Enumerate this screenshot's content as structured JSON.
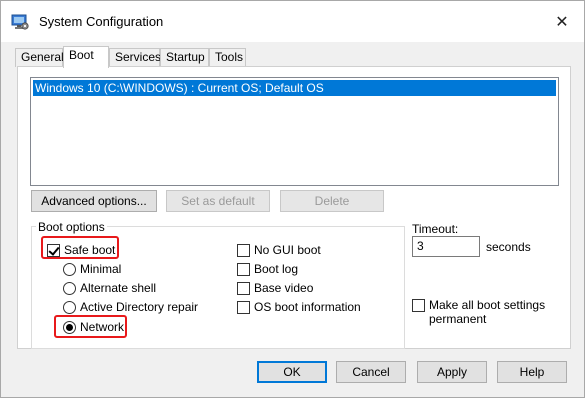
{
  "window": {
    "title": "System Configuration",
    "close_glyph": "✕",
    "app_icon": "monitor-gear-icon"
  },
  "tabs": [
    "General",
    "Boot",
    "Services",
    "Startup",
    "Tools"
  ],
  "active_tab": "Boot",
  "os_list": [
    "Windows 10 (C:\\WINDOWS) : Current OS; Default OS"
  ],
  "buttons": {
    "advanced": "Advanced options...",
    "set_default": "Set as default",
    "delete": "Delete"
  },
  "boot_options": {
    "label": "Boot options",
    "safe_boot": {
      "label": "Safe boot",
      "checked": true
    },
    "minimal": "Minimal",
    "alternate_shell": "Alternate shell",
    "ad_repair": "Active Directory repair",
    "network": {
      "label": "Network",
      "selected": true
    },
    "no_gui_boot": "No GUI boot",
    "boot_log": "Boot log",
    "base_video": "Base video",
    "os_boot_info": "OS boot information"
  },
  "timeout": {
    "label": "Timeout:",
    "value": "3",
    "unit": "seconds"
  },
  "make_permanent": {
    "line1": "Make all boot settings",
    "line2": "permanent"
  },
  "footer": {
    "ok": "OK",
    "cancel": "Cancel",
    "apply": "Apply",
    "help": "Help"
  },
  "colors": {
    "selection": "#0078d7",
    "highlight_box": "#e8191b",
    "window_bg": "#f0f0f0"
  }
}
